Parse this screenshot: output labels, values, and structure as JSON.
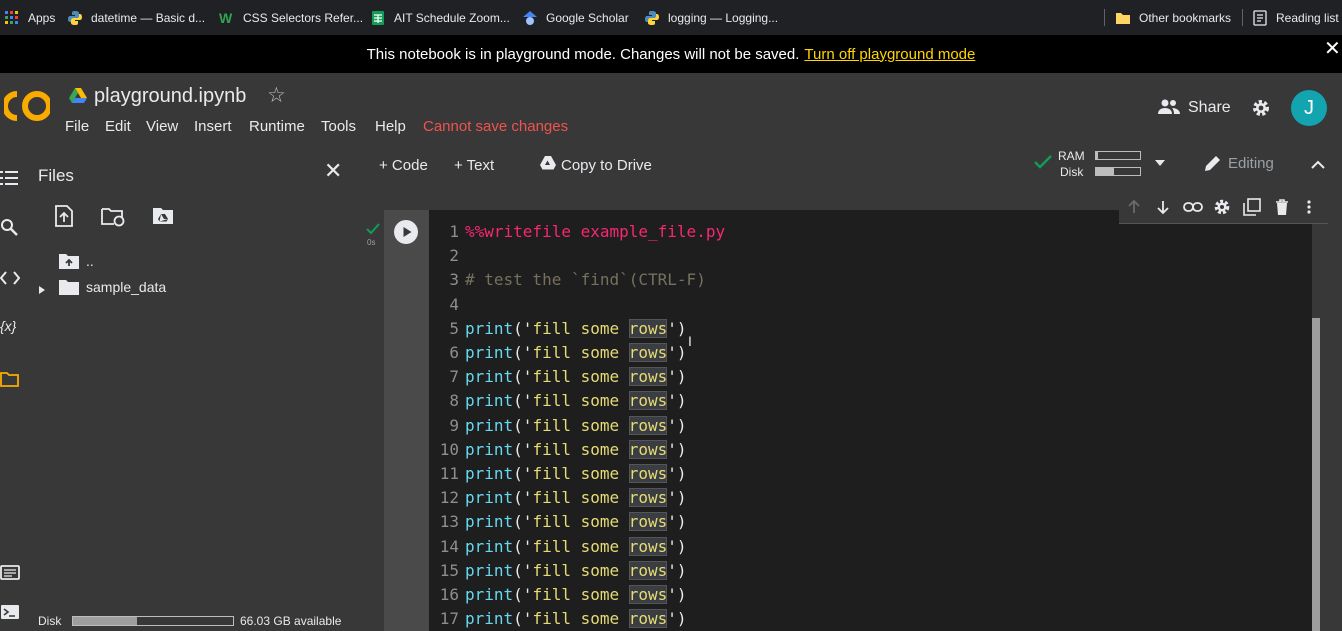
{
  "bookmarks": {
    "items": [
      {
        "label": "Apps"
      },
      {
        "label": "datetime — Basic d..."
      },
      {
        "label": "CSS Selectors Refer..."
      },
      {
        "label": "AIT Schedule Zoom..."
      },
      {
        "label": "Google Scholar"
      },
      {
        "label": "logging — Logging..."
      }
    ],
    "other": "Other bookmarks",
    "reading": "Reading list"
  },
  "banner": {
    "text": "This notebook is in playground mode. Changes will not be saved.",
    "link": "Turn off playground mode",
    "close": "✕"
  },
  "header": {
    "logo": "CO",
    "title": "playground.ipynb",
    "star": "☆",
    "menu": [
      "File",
      "Edit",
      "View",
      "Insert",
      "Runtime",
      "Tools",
      "Help"
    ],
    "warning": "Cannot save changes",
    "share": "Share",
    "avatar": "J"
  },
  "toolbar": {
    "code": "+ Code",
    "text": "+ Text",
    "copy": "Copy to Drive",
    "ram": "RAM",
    "disk": "Disk",
    "ram_usage": 0.05,
    "disk_usage": 0.4,
    "editing": "Editing"
  },
  "files": {
    "title": "Files",
    "close": "✕",
    "parent": "..",
    "folder": "sample_data",
    "disk_label": "Disk",
    "disk_avail": "66.03 GB available",
    "disk_usage": 0.4
  },
  "cell": {
    "exec_label": "0s",
    "lines": [
      {
        "n": "1",
        "text": "%%writefile example_file.py"
      },
      {
        "n": "2",
        "text": ""
      },
      {
        "n": "3",
        "text": "# test the `find`(CTRL-F)"
      },
      {
        "n": "4",
        "text": ""
      },
      {
        "n": "5",
        "a": "print",
        "b": "('",
        "c": "fill some ",
        "d": "rows",
        "e": "')"
      },
      {
        "n": "6",
        "a": "print",
        "b": "('",
        "c": "fill some ",
        "d": "rows",
        "e": "')"
      },
      {
        "n": "7",
        "a": "print",
        "b": "('",
        "c": "fill some ",
        "d": "rows",
        "e": "')"
      },
      {
        "n": "8",
        "a": "print",
        "b": "('",
        "c": "fill some ",
        "d": "rows",
        "e": "')"
      },
      {
        "n": "9",
        "a": "print",
        "b": "('",
        "c": "fill some ",
        "d": "rows",
        "e": "')"
      },
      {
        "n": "10",
        "a": "print",
        "b": "('",
        "c": "fill some ",
        "d": "rows",
        "e": "')"
      },
      {
        "n": "11",
        "a": "print",
        "b": "('",
        "c": "fill some ",
        "d": "rows",
        "e": "')"
      },
      {
        "n": "12",
        "a": "print",
        "b": "('",
        "c": "fill some ",
        "d": "rows",
        "e": "')"
      },
      {
        "n": "13",
        "a": "print",
        "b": "('",
        "c": "fill some ",
        "d": "rows",
        "e": "')"
      },
      {
        "n": "14",
        "a": "print",
        "b": "('",
        "c": "fill some ",
        "d": "rows",
        "e": "')"
      },
      {
        "n": "15",
        "a": "print",
        "b": "('",
        "c": "fill some ",
        "d": "rows",
        "e": "')"
      },
      {
        "n": "16",
        "a": "print",
        "b": "('",
        "c": "fill some ",
        "d": "rows",
        "e": "')"
      },
      {
        "n": "17",
        "a": "print",
        "b": "('",
        "c": "fill some ",
        "d": "rows",
        "e": "')"
      }
    ]
  },
  "colors": {
    "accent": "#f9ab00",
    "warning": "#ef5350",
    "avatar": "#12a4af",
    "link": "#ffd600"
  }
}
